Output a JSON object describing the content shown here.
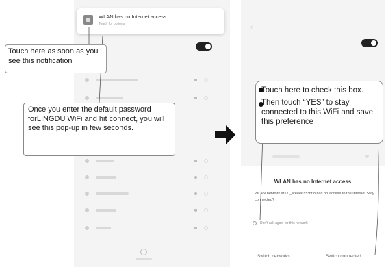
{
  "notification": {
    "title": "WLAN has no Internet access",
    "subtitle": "Touch for options"
  },
  "dialog": {
    "title": "WLAN has no Internet access",
    "message": "WLAN network M17 _Iceeeil333btio has no access to the internet.Stay connected?",
    "checkbox_label": "Don't ask again for this network",
    "buttons": {
      "switch_networks": "Switch networks",
      "switch_connected": "Switch connected"
    }
  },
  "callouts": {
    "notification_tip": "Touch here as soon as you see this notification",
    "password_tip": "Once you enter the default password forLINGDU WiFi and hit connect, you will see this pop-up in few seconds.",
    "checkbox_tip": "Touch here to check this box.",
    "yes_tip": "Then touch “YES” to stay connected to this WiFi and save this preference"
  },
  "colors": {
    "toggle_on": "#222222",
    "callout_border": "#9a9a9a",
    "arrow": "#111111"
  },
  "icons": {
    "notification": "app-icon",
    "wifi": "wifi-icon",
    "refresh": "refresh-icon",
    "arrow": "arrow-right-icon"
  }
}
